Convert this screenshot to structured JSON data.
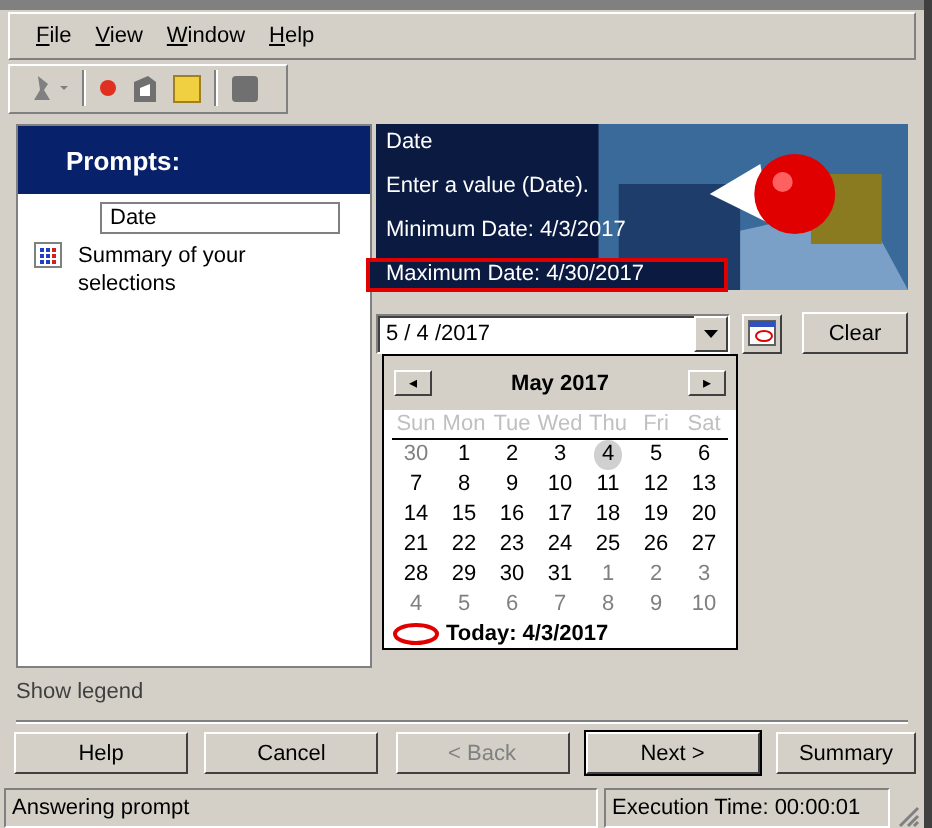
{
  "menu": [
    {
      "label": "File"
    },
    {
      "label": "View"
    },
    {
      "label": "Window"
    },
    {
      "label": "Help"
    }
  ],
  "prompts_panel": {
    "title": "Prompts:",
    "items": [
      {
        "label": "Date",
        "kind": "field",
        "selected": true
      },
      {
        "label": "Summary of your selections",
        "kind": "summary",
        "selected": false
      }
    ],
    "legend_link": "Show legend"
  },
  "banner": {
    "lines": [
      {
        "text": "Date",
        "highlighted": false
      },
      {
        "text": "Enter a value (Date).",
        "highlighted": false
      },
      {
        "text": "Minimum Date: 4/3/2017",
        "highlighted": false
      },
      {
        "text": "Maximum Date: 4/30/2017",
        "highlighted": true
      }
    ]
  },
  "date_field": {
    "value": "5 / 4 /2017"
  },
  "clear_button": "Clear",
  "calendar": {
    "month": "May 2017",
    "prev": "◂",
    "next": "▸",
    "weekdays": [
      "Sun",
      "Mon",
      "Tue",
      "Wed",
      "Thu",
      "Fri",
      "Sat"
    ],
    "weeks": [
      [
        {
          "day": "30",
          "other_month": true,
          "selected": false
        },
        {
          "day": "1",
          "other_month": false,
          "selected": false
        },
        {
          "day": "2",
          "other_month": false,
          "selected": false
        },
        {
          "day": "3",
          "other_month": false,
          "selected": false
        },
        {
          "day": "4",
          "other_month": false,
          "selected": true
        },
        {
          "day": "5",
          "other_month": false,
          "selected": false
        },
        {
          "day": "6",
          "other_month": false,
          "selected": false
        }
      ],
      [
        {
          "day": "7",
          "other_month": false,
          "selected": false
        },
        {
          "day": "8",
          "other_month": false,
          "selected": false
        },
        {
          "day": "9",
          "other_month": false,
          "selected": false
        },
        {
          "day": "10",
          "other_month": false,
          "selected": false
        },
        {
          "day": "11",
          "other_month": false,
          "selected": false
        },
        {
          "day": "12",
          "other_month": false,
          "selected": false
        },
        {
          "day": "13",
          "other_month": false,
          "selected": false
        }
      ],
      [
        {
          "day": "14",
          "other_month": false,
          "selected": false
        },
        {
          "day": "15",
          "other_month": false,
          "selected": false
        },
        {
          "day": "16",
          "other_month": false,
          "selected": false
        },
        {
          "day": "17",
          "other_month": false,
          "selected": false
        },
        {
          "day": "18",
          "other_month": false,
          "selected": false
        },
        {
          "day": "19",
          "other_month": false,
          "selected": false
        },
        {
          "day": "20",
          "other_month": false,
          "selected": false
        }
      ],
      [
        {
          "day": "21",
          "other_month": false,
          "selected": false
        },
        {
          "day": "22",
          "other_month": false,
          "selected": false
        },
        {
          "day": "23",
          "other_month": false,
          "selected": false
        },
        {
          "day": "24",
          "other_month": false,
          "selected": false
        },
        {
          "day": "25",
          "other_month": false,
          "selected": false
        },
        {
          "day": "26",
          "other_month": false,
          "selected": false
        },
        {
          "day": "27",
          "other_month": false,
          "selected": false
        }
      ],
      [
        {
          "day": "28",
          "other_month": false,
          "selected": false
        },
        {
          "day": "29",
          "other_month": false,
          "selected": false
        },
        {
          "day": "30",
          "other_month": false,
          "selected": false
        },
        {
          "day": "31",
          "other_month": false,
          "selected": false
        },
        {
          "day": "1",
          "other_month": true,
          "selected": false
        },
        {
          "day": "2",
          "other_month": true,
          "selected": false
        },
        {
          "day": "3",
          "other_month": true,
          "selected": false
        }
      ],
      [
        {
          "day": "4",
          "other_month": true,
          "selected": false
        },
        {
          "day": "5",
          "other_month": true,
          "selected": false
        },
        {
          "day": "6",
          "other_month": true,
          "selected": false
        },
        {
          "day": "7",
          "other_month": true,
          "selected": false
        },
        {
          "day": "8",
          "other_month": true,
          "selected": false
        },
        {
          "day": "9",
          "other_month": true,
          "selected": false
        },
        {
          "day": "10",
          "other_month": true,
          "selected": false
        }
      ]
    ],
    "today": "Today: 4/3/2017"
  },
  "buttons": [
    {
      "label": "Help",
      "disabled": false,
      "default": false
    },
    {
      "label": "Cancel",
      "disabled": false,
      "default": false
    },
    {
      "label": "< Back",
      "disabled": true,
      "default": false
    },
    {
      "label": "Next >",
      "disabled": false,
      "default": true
    },
    {
      "label": "Summary",
      "disabled": false,
      "default": false
    }
  ],
  "status_bar": {
    "message": "Answering prompt",
    "execution_time": "Execution Time: 00:00:01"
  }
}
